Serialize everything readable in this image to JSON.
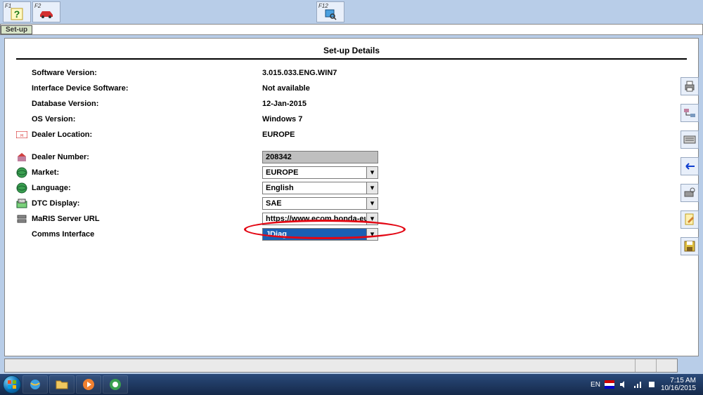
{
  "toolbar": {
    "f1": "F1",
    "f2": "F2",
    "f12": "F12"
  },
  "tab": {
    "label": "Set-up"
  },
  "panel": {
    "title": "Set-up Details"
  },
  "rows": {
    "swver": {
      "label": "Software Version:",
      "value": "3.015.033.ENG.WIN7"
    },
    "ifdev": {
      "label": "Interface Device Software:",
      "value": "Not available"
    },
    "dbver": {
      "label": "Database Version:",
      "value": "12-Jan-2015"
    },
    "osver": {
      "label": "OS Version:",
      "value": "Windows 7"
    },
    "dloc": {
      "label": "Dealer Location:",
      "value": "EUROPE"
    },
    "dnum": {
      "label": "Dealer Number:",
      "value": "208342"
    },
    "market": {
      "label": "Market:",
      "value": "EUROPE"
    },
    "lang": {
      "label": "Language:",
      "value": "English"
    },
    "dtc": {
      "label": "DTC Display:",
      "value": "SAE"
    },
    "maris": {
      "label": "MaRIS Server URL",
      "value": "https://www.ecom.honda-eu.com/er"
    },
    "comms": {
      "label": "Comms Interface",
      "value": "JDiag"
    }
  },
  "tray": {
    "lang": "EN",
    "time": "7:15 AM",
    "date": "10/16/2015"
  }
}
